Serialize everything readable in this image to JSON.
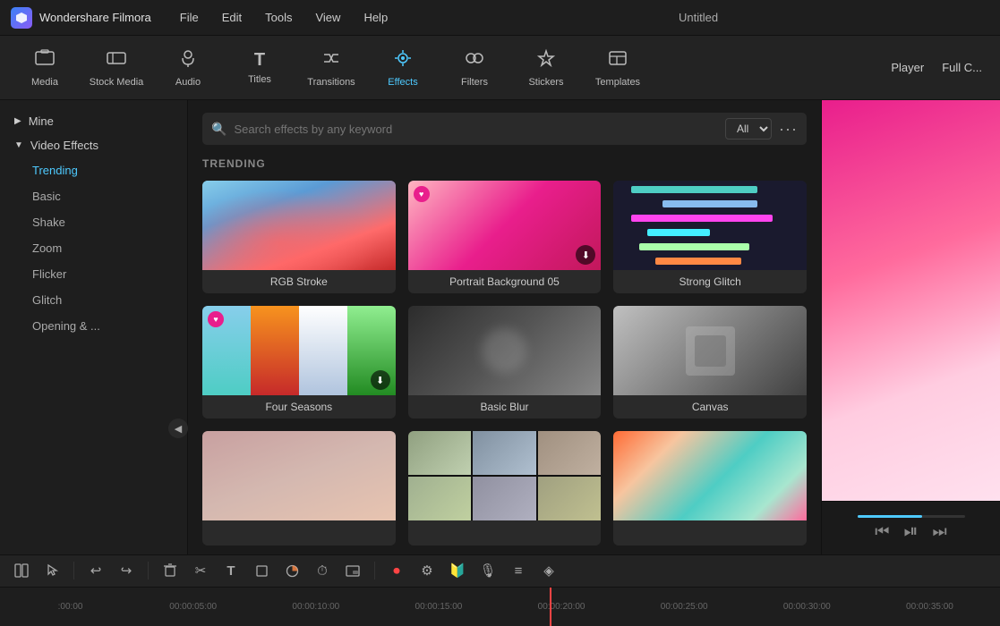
{
  "app": {
    "name": "Wondershare Filmora",
    "window_title": "Untitled"
  },
  "menu": {
    "items": [
      "File",
      "Edit",
      "Tools",
      "View",
      "Help"
    ]
  },
  "toolbar": {
    "items": [
      {
        "id": "media",
        "label": "Media",
        "icon": "🎬"
      },
      {
        "id": "stock_media",
        "label": "Stock Media",
        "icon": "🎞"
      },
      {
        "id": "audio",
        "label": "Audio",
        "icon": "🎵"
      },
      {
        "id": "titles",
        "label": "Titles",
        "icon": "T"
      },
      {
        "id": "transitions",
        "label": "Transitions",
        "icon": "↔"
      },
      {
        "id": "effects",
        "label": "Effects",
        "icon": "✨"
      },
      {
        "id": "filters",
        "label": "Filters",
        "icon": "🎨"
      },
      {
        "id": "stickers",
        "label": "Stickers",
        "icon": "⭐"
      },
      {
        "id": "templates",
        "label": "Templates",
        "icon": "⬛"
      }
    ],
    "active": "effects",
    "player_label": "Player",
    "fullscreen_label": "Full C..."
  },
  "sidebar": {
    "mine_label": "Mine",
    "video_effects_label": "Video Effects",
    "items": [
      {
        "id": "trending",
        "label": "Trending",
        "active": true
      },
      {
        "id": "basic",
        "label": "Basic"
      },
      {
        "id": "shake",
        "label": "Shake"
      },
      {
        "id": "zoom",
        "label": "Zoom"
      },
      {
        "id": "flicker",
        "label": "Flicker"
      },
      {
        "id": "glitch",
        "label": "Glitch"
      },
      {
        "id": "opening",
        "label": "Opening & ..."
      }
    ]
  },
  "search": {
    "placeholder": "Search effects by any keyword",
    "filter_label": "All"
  },
  "content": {
    "section_title": "TRENDING",
    "effects": [
      {
        "id": "rgb_stroke",
        "name": "RGB Stroke",
        "premium": false,
        "download": false
      },
      {
        "id": "portrait_bg_05",
        "name": "Portrait Background 05",
        "premium": true,
        "download": true
      },
      {
        "id": "strong_glitch",
        "name": "Strong Glitch",
        "premium": false,
        "download": false
      },
      {
        "id": "four_seasons",
        "name": "Four Seasons",
        "premium": true,
        "download": true
      },
      {
        "id": "basic_blur",
        "name": "Basic Blur",
        "premium": false,
        "download": false
      },
      {
        "id": "canvas",
        "name": "Canvas",
        "premium": false,
        "download": false
      },
      {
        "id": "card7",
        "name": "",
        "premium": false,
        "download": false
      },
      {
        "id": "card8",
        "name": "",
        "premium": false,
        "download": false
      },
      {
        "id": "card9",
        "name": "",
        "premium": false,
        "download": false
      }
    ]
  },
  "timeline": {
    "timestamps": [
      ":00:00",
      "00:00:05:00",
      "00:00:10:00",
      "00:00:15:00",
      "00:00:20:00",
      "00:00:25:00",
      "00:00:30:00",
      "00:00:35:00"
    ]
  },
  "timeline_toolbar": {
    "buttons": [
      {
        "id": "split",
        "icon": "⊞"
      },
      {
        "id": "select",
        "icon": "↖"
      },
      {
        "id": "undo",
        "icon": "↩"
      },
      {
        "id": "redo",
        "icon": "↪"
      },
      {
        "id": "delete",
        "icon": "🗑"
      },
      {
        "id": "cut",
        "icon": "✂"
      },
      {
        "id": "text",
        "icon": "T"
      },
      {
        "id": "crop",
        "icon": "⬜"
      },
      {
        "id": "color",
        "icon": "⬤"
      },
      {
        "id": "timer",
        "icon": "⏱"
      },
      {
        "id": "pip",
        "icon": "⧉"
      },
      {
        "id": "record",
        "icon": "⏺"
      },
      {
        "id": "settings2",
        "icon": "⚙"
      },
      {
        "id": "mask",
        "icon": "🔰"
      },
      {
        "id": "mic",
        "icon": "🎙"
      },
      {
        "id": "layers",
        "icon": "≡"
      },
      {
        "id": "ai",
        "icon": "◈"
      }
    ]
  }
}
